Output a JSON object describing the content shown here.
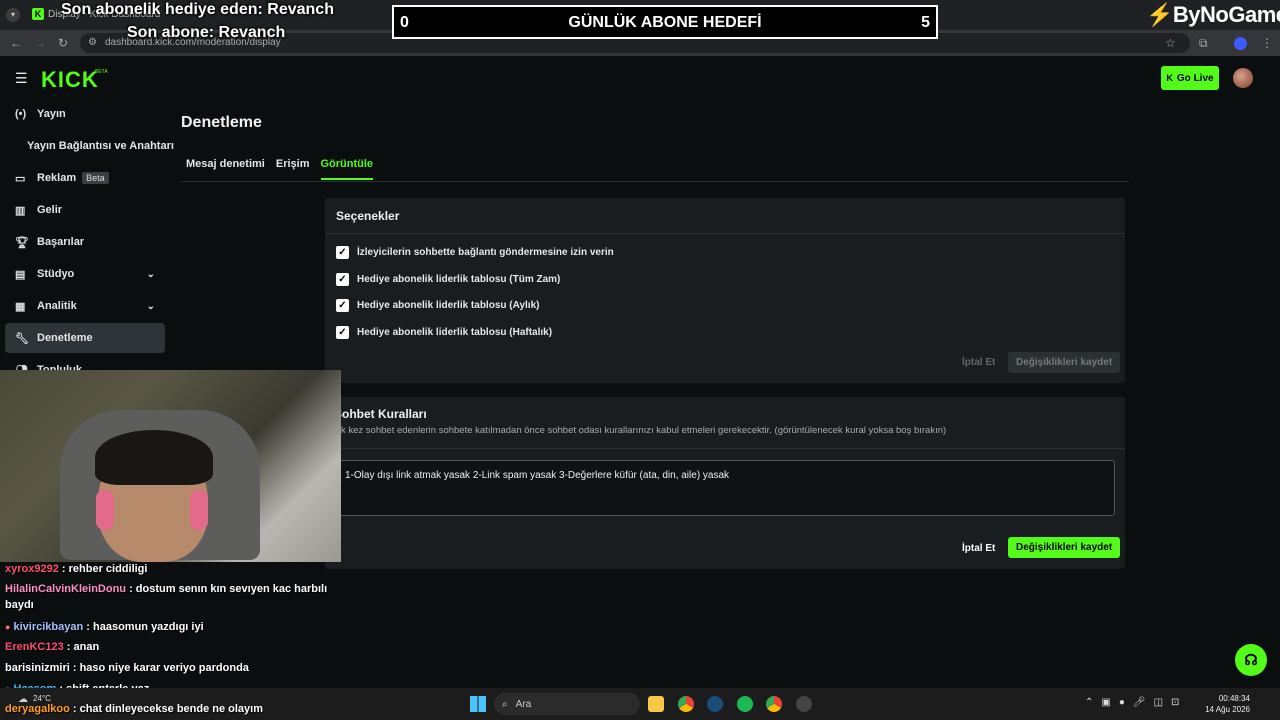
{
  "browser": {
    "tab_title": "Display - Kick Dashboard",
    "url": "dashboard.kick.com/moderation/display"
  },
  "overlay": {
    "gift_line": "Son abonelik hediye eden: Revanch",
    "sub_line": "Son abone: Revanch",
    "goal_current": "0",
    "goal_title": "GÜNLÜK ABONE HEDEFİ",
    "goal_target": "5",
    "brand": "ByNoGame"
  },
  "header": {
    "logo": "KICK",
    "logo_badge": "BETA",
    "go_live": "Go Live"
  },
  "sidebar": {
    "items": [
      {
        "label": "Yayın",
        "icon": "broadcast-icon"
      },
      {
        "label": "Yayın Bağlantısı ve Anahtarı",
        "icon": ""
      },
      {
        "label": "Reklam",
        "icon": "ad-icon",
        "badge": "Beta"
      },
      {
        "label": "Gelir",
        "icon": "revenue-icon"
      },
      {
        "label": "Başarılar",
        "icon": "trophy-icon"
      },
      {
        "label": "Stüdyo",
        "icon": "studio-icon"
      },
      {
        "label": "Analitik",
        "icon": "analytics-icon"
      },
      {
        "label": "Denetleme",
        "icon": "wrench-icon"
      },
      {
        "label": "Topluluk",
        "icon": "community-icon"
      }
    ]
  },
  "main": {
    "title": "Denetleme",
    "tabs": [
      "Mesaj denetimi",
      "Erişim",
      "Görüntüle"
    ],
    "active_tab": "Görüntüle",
    "options_panel": {
      "title": "Seçenekler",
      "checkboxes": [
        {
          "label": "İzleyicilerin sohbette bağlantı göndermesine izin verin",
          "checked": true
        },
        {
          "label": "Hediye abonelik liderlik tablosu (Tüm Zam)",
          "checked": true
        },
        {
          "label": "Hediye abonelik liderlik tablosu (Aylık)",
          "checked": true
        },
        {
          "label": "Hediye abonelik liderlik tablosu (Haftalık)",
          "checked": true
        }
      ],
      "cancel": "İptal Et",
      "save": "Değişiklikleri kaydet"
    },
    "rules_panel": {
      "title": "Sohbet Kuralları",
      "description": "k kez sohbet edenlerin sohbete katılmadan önce sohbet odası kurallarınızı kabul etmeleri gerekecektir. (görüntülenecek kural yoksa boş bırakın)",
      "rules_text": "1-Olay dışı link atmak yasak 2-Link spam yasak 3-Değerlere küfür (ata, din, aile) yasak",
      "cancel": "İptal Et",
      "save": "Değişiklikleri kaydet"
    }
  },
  "chat": [
    {
      "user": "xyrox9292",
      "msg": ": rehber ciddiligi",
      "color": "#ff4d6d"
    },
    {
      "user": "HilalinCalvinKleinDonu",
      "msg": ": dostum senın kın sevıyen kac harbılı baydı",
      "color": "#ff8fc8"
    },
    {
      "user": "kivircikbayan",
      "msg": ": haasomun yazdıgı iyi",
      "color": "#9fc3ff"
    },
    {
      "user": "ErenKC123",
      "msg": ": anan",
      "color": "#ff4d6d"
    },
    {
      "user": "barisinizmiri",
      "msg": ": haso niye karar veriyo pardonda",
      "color": "#ffffff"
    },
    {
      "user": "Haasom",
      "msg": ": shift enterle yaz",
      "color": "#40c4ff"
    },
    {
      "user": "deryagalkoo",
      "msg": ": chat dinleyecekse bende ne olayım",
      "color": "#ff9f1c"
    }
  ],
  "taskbar": {
    "search_placeholder": "Ara",
    "weather": "24°C",
    "time": "00:48:34",
    "date": "14 Ağu 2026"
  }
}
